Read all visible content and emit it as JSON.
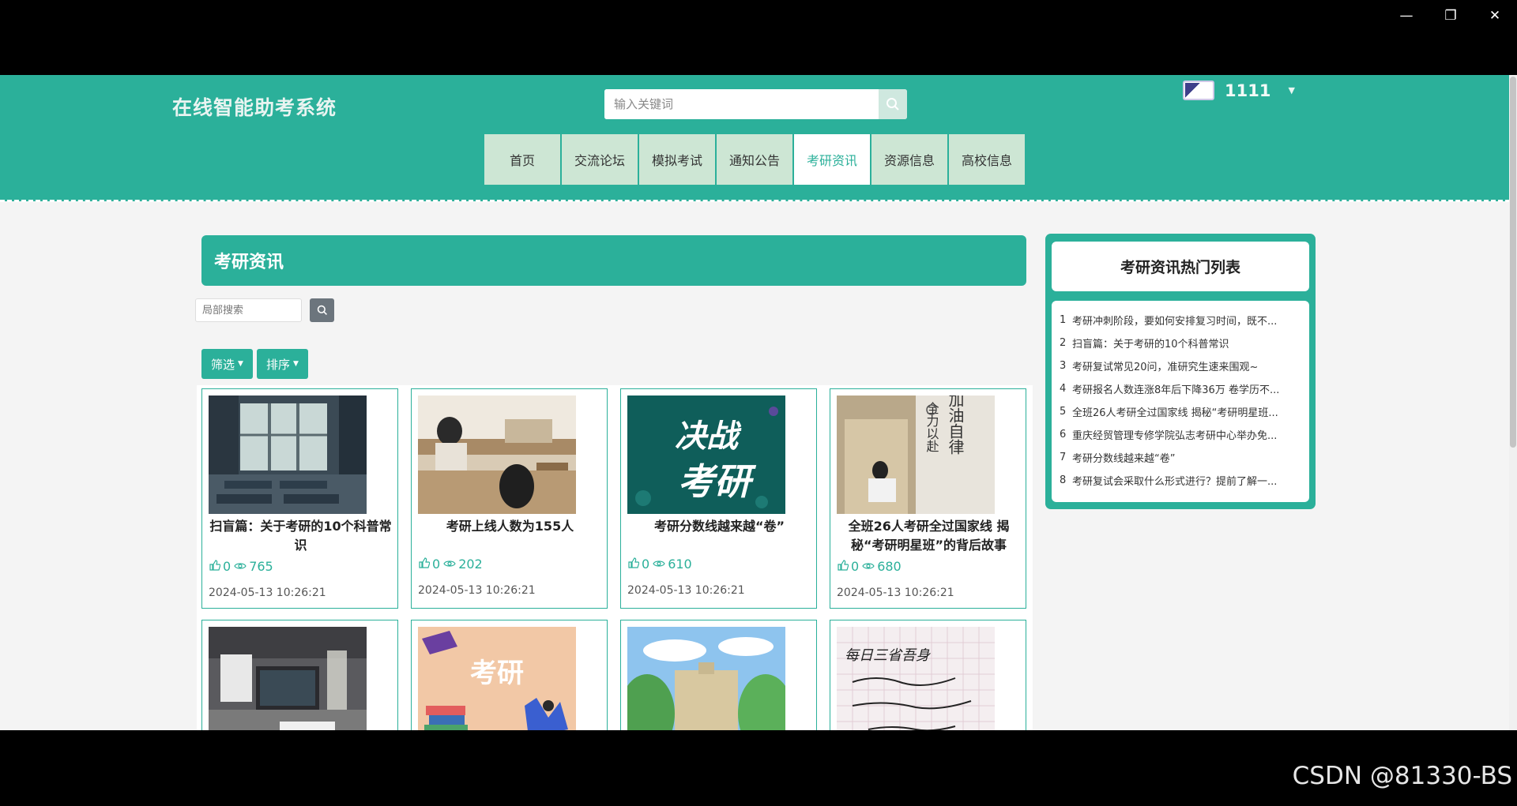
{
  "window": {
    "minimize_icon": "minimize-icon",
    "restore_icon": "restore-icon",
    "close_icon": "close-icon"
  },
  "header": {
    "brand": "在线智能助考系统",
    "search_placeholder": "输入关键词",
    "username": "1111",
    "nav": [
      "首页",
      "交流论坛",
      "模拟考试",
      "通知公告",
      "考研资讯",
      "资源信息",
      "高校信息"
    ],
    "active_nav": "考研资讯"
  },
  "main": {
    "title": "考研资讯",
    "local_search_placeholder": "局部搜索",
    "filter_label": "筛选",
    "sort_label": "排序",
    "cards": [
      {
        "title": "扫盲篇：关于考研的10个科普常识",
        "likes": "0",
        "views": "765",
        "date": "2024-05-13 10:26:21"
      },
      {
        "title": "考研上线人数为155人",
        "likes": "0",
        "views": "202",
        "date": "2024-05-13 10:26:21"
      },
      {
        "title": "考研分数线越来越“卷”",
        "likes": "0",
        "views": "610",
        "date": "2024-05-13 10:26:21"
      },
      {
        "title": "全班26人考研全过国家线 揭秘“考研明星班”的背后故事",
        "likes": "0",
        "views": "680",
        "date": "2024-05-13 10:26:21"
      }
    ],
    "image_text": {
      "card3_line1": "决战",
      "card3_line2": "考研",
      "card4_v1": "加油自律",
      "card4_v2": "全力以赴",
      "card6": "考研",
      "card8": "每日三省吾身"
    }
  },
  "sidebar": {
    "title": "考研资讯热门列表",
    "items": [
      {
        "idx": "1",
        "text": "考研冲刺阶段，要如何安排复习时间，既不..."
      },
      {
        "idx": "2",
        "text": "扫盲篇：关于考研的10个科普常识"
      },
      {
        "idx": "3",
        "text": "考研复试常见20问，准研究生速来围观~"
      },
      {
        "idx": "4",
        "text": "考研报名人数连涨8年后下降36万 卷学历不..."
      },
      {
        "idx": "5",
        "text": "全班26人考研全过国家线 揭秘“考研明星班..."
      },
      {
        "idx": "6",
        "text": "重庆经贸管理专修学院弘志考研中心举办免..."
      },
      {
        "idx": "7",
        "text": "考研分数线越来越“卷”"
      },
      {
        "idx": "8",
        "text": "考研复试会采取什么形式进行？提前了解一..."
      }
    ]
  },
  "watermark": "CSDN @81330-BS",
  "colors": {
    "accent": "#2bb09a",
    "nav_bg": "#cde6d4"
  }
}
